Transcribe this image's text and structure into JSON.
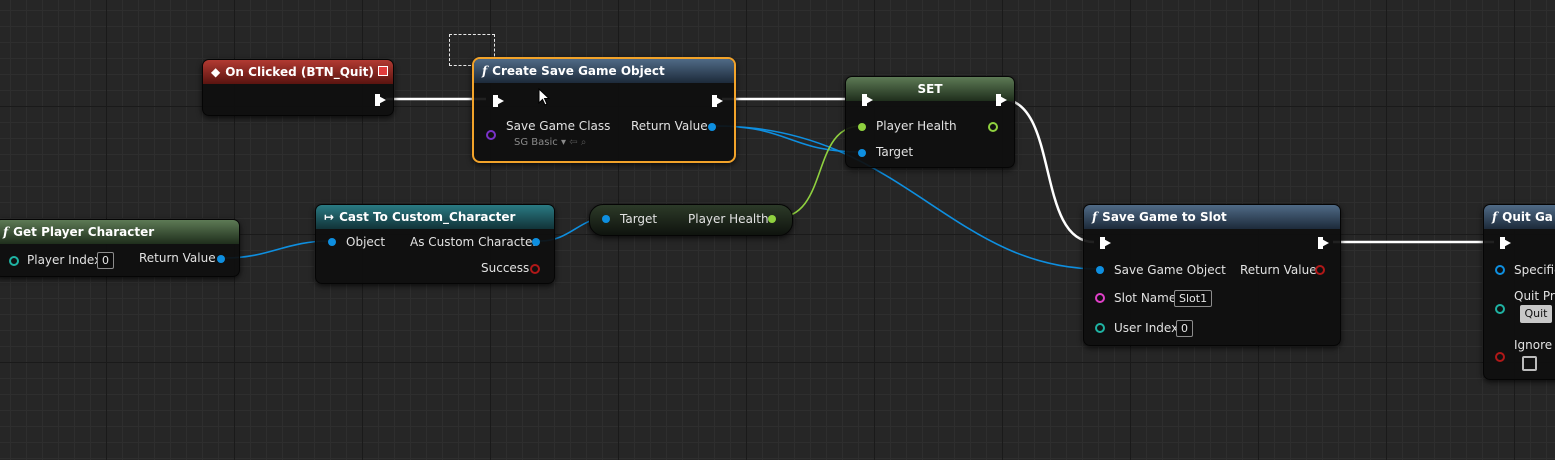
{
  "nodes": {
    "on_clicked": {
      "title": "On Clicked (BTN_Quit)"
    },
    "create_save": {
      "title": "Create Save Game Object",
      "class_label": "Save Game Class",
      "class_value": "SG Basic",
      "return_label": "Return Value"
    },
    "set": {
      "title": "SET",
      "health_label": "Player Health",
      "target_label": "Target"
    },
    "get_player": {
      "title": "Get Player Character",
      "index_label": "Player Index",
      "index_value": "0",
      "return_label": "Return Value"
    },
    "cast": {
      "title": "Cast To Custom_Character",
      "object_label": "Object",
      "as_label": "As Custom Character",
      "success_label": "Success"
    },
    "get_health": {
      "target_label": "Target",
      "health_label": "Player Health"
    },
    "save_slot": {
      "title": "Save Game to Slot",
      "object_label": "Save Game Object",
      "return_label": "Return Value",
      "slot_label": "Slot Name",
      "slot_value": "Slot1",
      "user_label": "User Index",
      "user_value": "0"
    },
    "quit_game": {
      "title": "Quit Ga",
      "specific_label": "Specific",
      "pref_label": "Quit Pr",
      "pref_value": "Quit",
      "ignore_label": "Ignore"
    }
  },
  "colors": {
    "exec": "#ffffff",
    "object": "#0e8fe0",
    "float": "#8fd13f",
    "class": "#7a32c8",
    "integer": "#1fb3a3",
    "string": "#e040c8",
    "bool": "#b01818",
    "selection": "#f2a32a"
  }
}
